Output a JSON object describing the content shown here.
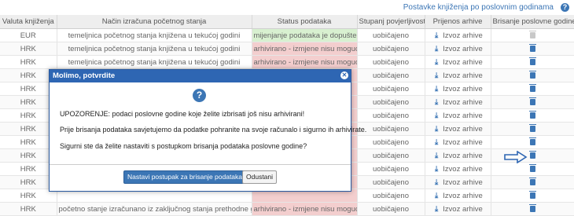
{
  "header": {
    "title": "Postavke knjiženja po poslovnim godinama",
    "help_icon": "?"
  },
  "table": {
    "columns": [
      "Valuta knjiženja",
      "Način izračuna početnog stanja",
      "Status podataka",
      "Stupanj povjerljivosti",
      "Prijenos arhive",
      "Brisanje poslovne godine"
    ],
    "rows": [
      {
        "currency": "EUR",
        "method": "temeljnica početnog stanja knjižena u tekućoj godini",
        "status": "mijenjanje podataka je dopušteno",
        "status_type": "green",
        "confidentiality": "uobičajeno",
        "archive": "Izvoz arhive",
        "delete_enabled": false
      },
      {
        "currency": "HRK",
        "method": "temeljnica početnog stanja knjižena u tekućoj godini",
        "status": "arhivirano - izmjene nisu moguće",
        "status_type": "red",
        "confidentiality": "uobičajeno",
        "archive": "Izvoz arhive",
        "delete_enabled": true
      },
      {
        "currency": "HRK",
        "method": "temeljnica početnog stanja knjižena u tekućoj godini",
        "status": "arhivirano - izmjene nisu moguće",
        "status_type": "red",
        "confidentiality": "uobičajeno",
        "archive": "Izvoz arhive",
        "delete_enabled": true
      },
      {
        "currency": "HRK",
        "method": "",
        "status": "",
        "status_type": "red",
        "confidentiality": "uobičajeno",
        "archive": "Izvoz arhive",
        "delete_enabled": true
      },
      {
        "currency": "HRK",
        "method": "",
        "status": "",
        "status_type": "red",
        "confidentiality": "uobičajeno",
        "archive": "Izvoz arhive",
        "delete_enabled": true
      },
      {
        "currency": "HRK",
        "method": "",
        "status": "",
        "status_type": "red",
        "confidentiality": "uobičajeno",
        "archive": "Izvoz arhive",
        "delete_enabled": true
      },
      {
        "currency": "HRK",
        "method": "",
        "status": "",
        "status_type": "red",
        "confidentiality": "uobičajeno",
        "archive": "Izvoz arhive",
        "delete_enabled": true
      },
      {
        "currency": "HRK",
        "method": "",
        "status": "",
        "status_type": "red",
        "confidentiality": "uobičajeno",
        "archive": "Izvoz arhive",
        "delete_enabled": true
      },
      {
        "currency": "HRK",
        "method": "",
        "status": "",
        "status_type": "red",
        "confidentiality": "uobičajeno",
        "archive": "Izvoz arhive",
        "delete_enabled": true
      },
      {
        "currency": "HRK",
        "method": "",
        "status": "",
        "status_type": "red",
        "confidentiality": "uobičajeno",
        "archive": "Izvoz arhive",
        "delete_enabled": true
      },
      {
        "currency": "HRK",
        "method": "",
        "status": "",
        "status_type": "red",
        "confidentiality": "uobičajeno",
        "archive": "Izvoz arhive",
        "delete_enabled": true
      },
      {
        "currency": "HRK",
        "method": "",
        "status": "",
        "status_type": "red",
        "confidentiality": "uobičajeno",
        "archive": "Izvoz arhive",
        "delete_enabled": true
      },
      {
        "currency": "HRK",
        "method": "",
        "status": "",
        "status_type": "red",
        "confidentiality": "uobičajeno",
        "archive": "Izvoz arhive",
        "delete_enabled": true
      },
      {
        "currency": "HRK",
        "method": "početno stanje izračunano iz zaključnog stanja prethodne godine",
        "status": "arhivirano - izmjene nisu moguće",
        "status_type": "red",
        "confidentiality": "uobičajeno",
        "archive": "Izvoz arhive",
        "delete_enabled": true
      }
    ]
  },
  "dialog": {
    "title": "Molimo, potvrdite",
    "question_icon": "?",
    "warning": "UPOZORENJE: podaci poslovne godine koje želite izbrisati još nisu arhivirani!",
    "advice": "Prije brisanja podataka savjetujemo da podatke pohranite na svoje računalo i sigurno ih arhivirate.",
    "confirm_question": "Sigurni ste da želite nastaviti s postupkom brisanja podataka poslovne godine?",
    "confirm_button": "Nastavi postupak za brisanje podataka",
    "cancel_button": "Odustani"
  },
  "colors": {
    "accent": "#3c76b5",
    "status_green": "#d8f0d0",
    "status_red": "#f3cece",
    "dialog_header": "#2e66b3"
  }
}
